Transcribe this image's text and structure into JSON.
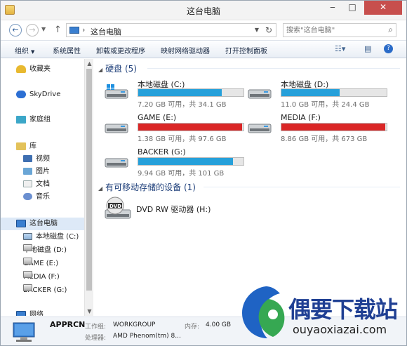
{
  "window": {
    "title": "这台电脑"
  },
  "address": {
    "path": "这台电脑"
  },
  "search": {
    "placeholder": "搜索\"这台电脑\""
  },
  "commands": [
    {
      "label": "组织"
    },
    {
      "label": "系统属性"
    },
    {
      "label": "卸载或更改程序"
    },
    {
      "label": "映射网络驱动器"
    },
    {
      "label": "打开控制面板"
    }
  ],
  "sidebar": {
    "favorites": "收藏夹",
    "skydrive": "SkyDrive",
    "homegroup": "家庭组",
    "libraries": "库",
    "lib_items": [
      "视频",
      "图片",
      "文档",
      "音乐"
    ],
    "thispc": "这台电脑",
    "drives": [
      "本地磁盘 (C:)",
      "本地磁盘 (D:)",
      "GAME (E:)",
      "MEDIA (F:)",
      "BACKER (G:)"
    ],
    "network": "网络"
  },
  "groups": {
    "hard_disks": "硬盘 (5)",
    "removable": "有可移动存储的设备 (1)"
  },
  "drives": [
    {
      "name": "本地磁盘 (C:)",
      "info": "7.20 GB 可用，共 34.1 GB",
      "used": 0.79,
      "color": "#26a0da"
    },
    {
      "name": "本地磁盘 (D:)",
      "info": "11.0 GB 可用，共 24.4 GB",
      "used": 0.55,
      "color": "#26a0da"
    },
    {
      "name": "GAME (E:)",
      "info": "1.38 GB 可用，共 97.6 GB",
      "used": 0.986,
      "color": "#da2626"
    },
    {
      "name": "MEDIA (F:)",
      "info": "8.86 GB 可用，共 673 GB",
      "used": 0.987,
      "color": "#da2626"
    },
    {
      "name": "BACKER (G:)",
      "info": "9.94 GB 可用，共 101 GB",
      "used": 0.9,
      "color": "#26a0da"
    }
  ],
  "dvd": {
    "name": "DVD RW 驱动器 (H:)"
  },
  "details": {
    "computer": "APPRCN",
    "workgroup_label": "工作组:",
    "workgroup": "WORKGROUP",
    "memory_label": "内存:",
    "memory": "4.00 GB",
    "cpu_label": "处理器:",
    "cpu": "AMD Phenom(tm) 8..."
  },
  "watermark": {
    "title": "偶要下载站",
    "url": "ouyaoxiazai.com"
  }
}
